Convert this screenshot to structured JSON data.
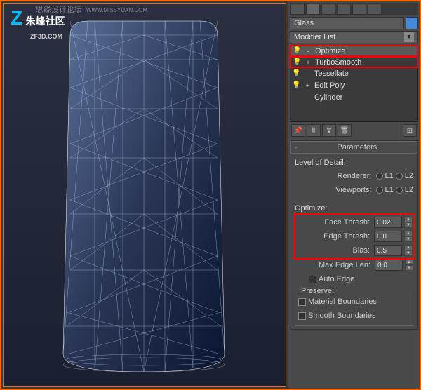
{
  "watermarks": {
    "top": "思缘设计论坛",
    "url_top": "WWW.MISSYUAN.COM",
    "logo_chars": "朱峰社区",
    "logo_url": "ZF3D.COM"
  },
  "panel": {
    "object_name": "Glass",
    "modifier_list_label": "Modifier List",
    "stack": [
      {
        "label": "Optimize",
        "highlighted": true,
        "expand": "-",
        "bulb": "💡"
      },
      {
        "label": "TurboSmooth",
        "highlighted": true,
        "expand": "+",
        "bulb": "💡"
      },
      {
        "label": "Tessellate",
        "highlighted": false,
        "expand": "",
        "bulb": "💡"
      },
      {
        "label": "Edit Poly",
        "highlighted": false,
        "expand": "+",
        "bulb": "💡"
      },
      {
        "label": "Cylinder",
        "highlighted": false,
        "expand": "",
        "bulb": ""
      }
    ],
    "rollout": {
      "title": "Parameters",
      "level_of_detail": "Level of Detail:",
      "renderer": "Renderer:",
      "viewports": "Viewports:",
      "l1": "L1",
      "l2": "L2",
      "optimize_label": "Optimize:",
      "face_thresh": {
        "label": "Face Thresh:",
        "value": "0.02"
      },
      "edge_thresh": {
        "label": "Edge Thresh:",
        "value": "0.0"
      },
      "bias": {
        "label": "Bias:",
        "value": "0.5"
      },
      "max_edge_len": {
        "label": "Max Edge Len:",
        "value": "0.0"
      },
      "auto_edge": "Auto Edge",
      "preserve": "Preserve:",
      "material_boundaries": "Material Boundaries",
      "smooth_boundaries": "Smooth Boundaries"
    }
  }
}
